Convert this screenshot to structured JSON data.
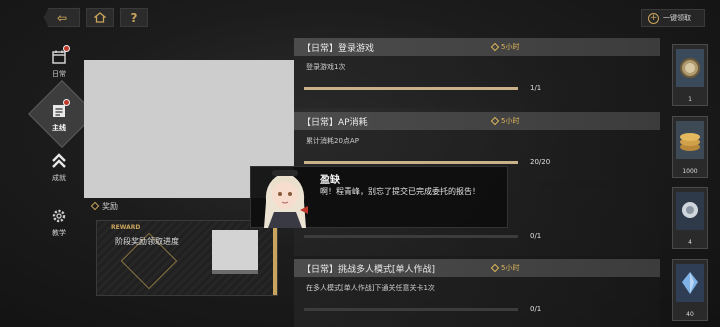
{
  "topbar": {
    "claim_all_label": "一键领取",
    "help_label": "?"
  },
  "sidebar": {
    "items": [
      {
        "label": "日常",
        "icon": "daily-calendar-icon",
        "badge": true
      },
      {
        "label": "主线",
        "icon": "mainline-book-icon",
        "badge": true,
        "active": true
      },
      {
        "label": "成就",
        "icon": "achievement-chevron-icon",
        "badge": false
      },
      {
        "label": "教学",
        "icon": "tutorial-gear-icon",
        "badge": false
      }
    ]
  },
  "reward": {
    "label": "奖励",
    "panel_tag": "REWARD",
    "panel_text": "阶段奖励领取进度"
  },
  "quests": [
    {
      "title": "【日常】登录游戏",
      "time": "5小时",
      "desc": "登录游戏1次",
      "current": 1,
      "total": 1,
      "progress_text": "1/1",
      "item_count": "1"
    },
    {
      "title": "【日常】AP消耗",
      "time": "5小时",
      "desc": "累计消耗20点AP",
      "current": 20,
      "total": 20,
      "progress_text": "20/20",
      "item_count": "1000"
    },
    {
      "title": "",
      "time": "",
      "desc": "",
      "current": 0,
      "total": 1,
      "progress_text": "0/1",
      "item_count": "4"
    },
    {
      "title": "【日常】挑战多人模式[单人作战]",
      "time": "5小时",
      "desc": "在多人模式[单人作战]下通关任意关卡1次",
      "current": 0,
      "total": 1,
      "progress_text": "0/1",
      "item_count": "40"
    }
  ],
  "dialog": {
    "speaker": "盈缺",
    "line": "啊！程青峰，别忘了提交已完成委托的报告！"
  },
  "colors": {
    "accent": "#c9a45c",
    "timer": "#e2b85c",
    "progress_fill": "#c9b28a"
  }
}
